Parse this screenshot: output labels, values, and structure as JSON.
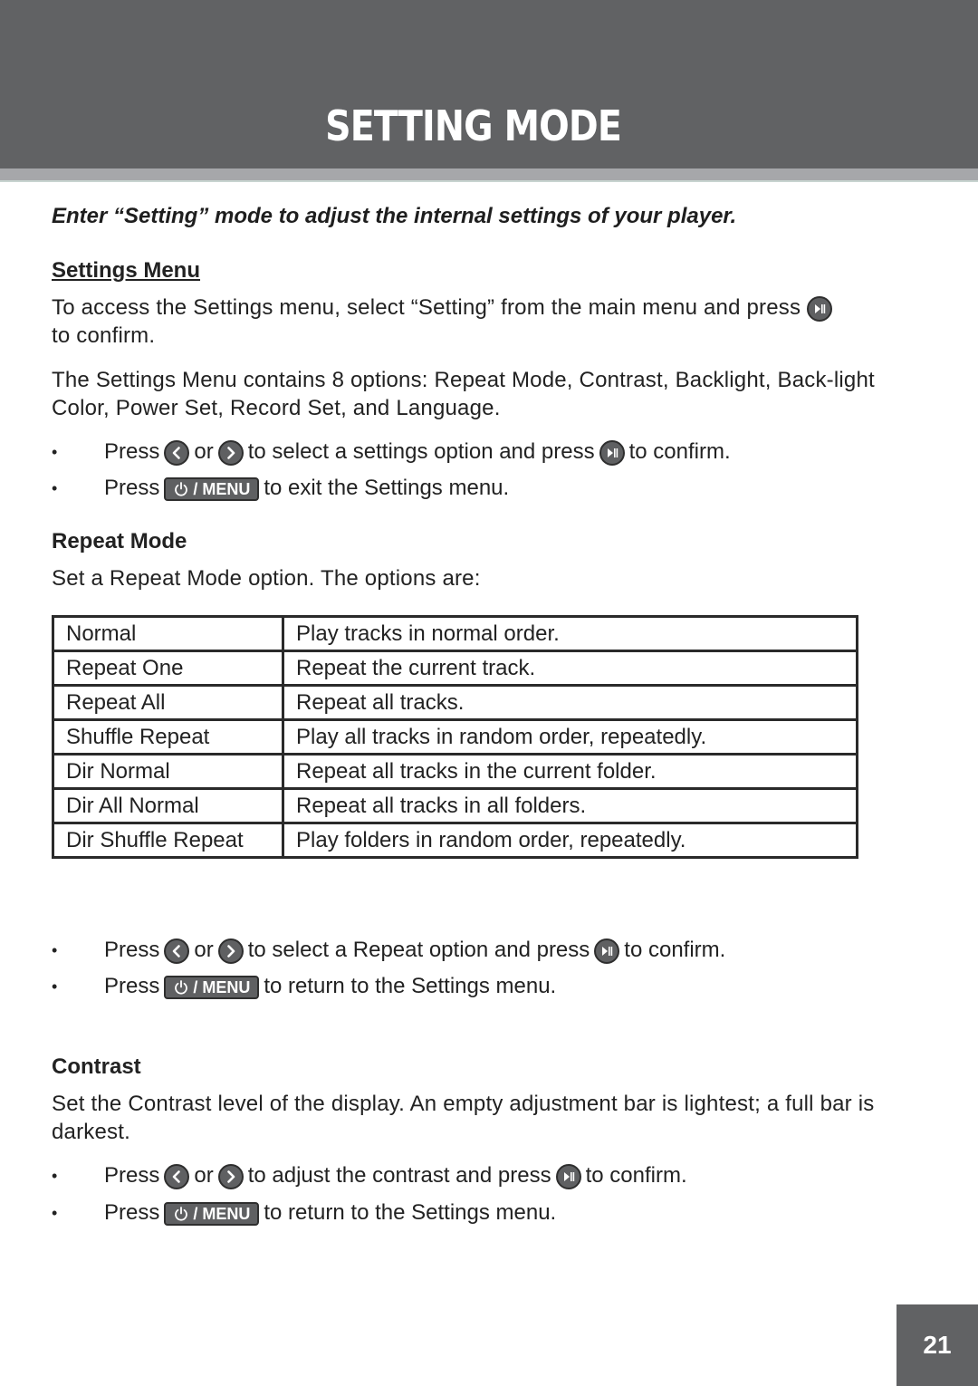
{
  "header": {
    "title": "SETTING MODE",
    "colors": {
      "band": "#616264",
      "strip": "#a6a7aa"
    }
  },
  "intro": "Enter “Setting” mode to adjust the internal settings of your player.",
  "settings_menu": {
    "heading": "Settings Menu",
    "para1_a": "To access the Settings menu, select “Setting” from the main menu and press",
    "para1_b": "to confirm.",
    "para2": "The Settings Menu contains 8 options: Repeat Mode, Contrast, Backlight, Back-light Color, Power Set, Record Set, and Language.",
    "bullets": [
      {
        "press": "Press",
        "or": "or",
        "mid": "to select a settings option and press",
        "end": "to confirm."
      },
      {
        "press": "Press",
        "end": "to exit the Settings menu."
      }
    ]
  },
  "repeat_mode": {
    "heading": "Repeat Mode",
    "para": "Set a Repeat Mode option. The options are:",
    "table": [
      {
        "option": "Normal",
        "description": "Play tracks in normal order."
      },
      {
        "option": "Repeat One",
        "description": "Repeat the current track."
      },
      {
        "option": "Repeat All",
        "description": "Repeat all tracks."
      },
      {
        "option": "Shuffle Repeat",
        "description": "Play all tracks in random order, repeatedly."
      },
      {
        "option": "Dir Normal",
        "description": "Repeat all tracks in the current folder."
      },
      {
        "option": "Dir All Normal",
        "description": "Repeat all tracks in all folders."
      },
      {
        "option": "Dir Shuffle Repeat",
        "description": "Play folders in random order, repeatedly."
      }
    ],
    "bullets": [
      {
        "press": "Press",
        "or": "or",
        "mid": "to select a Repeat option and press",
        "end": "to confirm."
      },
      {
        "press": "Press",
        "end": "to return to the Settings menu."
      }
    ]
  },
  "contrast": {
    "heading": "Contrast",
    "para": "Set the Contrast level of the display. An empty adjustment bar is lightest; a full bar is darkest.",
    "bullets": [
      {
        "press": "Press",
        "or": "or",
        "mid": "to adjust the contrast and press",
        "end": "to confirm."
      },
      {
        "press": "Press",
        "end": "to return to the Settings menu."
      }
    ]
  },
  "buttons": {
    "menu_label": "/ MENU",
    "icons": [
      "left-arrow-icon",
      "right-arrow-icon",
      "play-pause-icon",
      "power-icon"
    ]
  },
  "bullet_char": "•",
  "page_number": "21"
}
